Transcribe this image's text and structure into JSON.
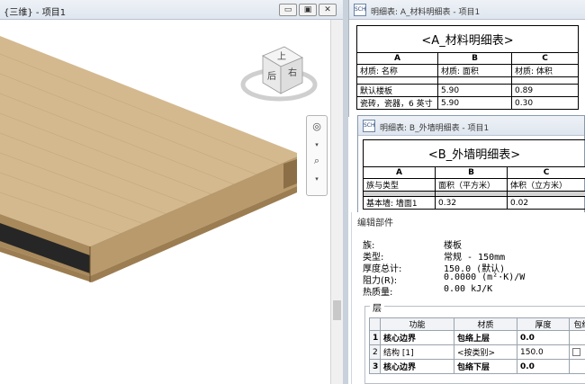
{
  "view3d": {
    "title": "{三维} - 项目1",
    "buttons": {
      "minimize": "▭",
      "restore": "▣",
      "close": "✕"
    },
    "viewcube": {
      "face_top": "上",
      "face_back": "后",
      "face_right": "右"
    }
  },
  "scheduleA": {
    "window_title": "明细表: A_材料明细表 - 项目1",
    "icon_text": "SCH",
    "title": "<A_材料明细表>",
    "letters": [
      "A",
      "B",
      "C"
    ],
    "headers": [
      "材质: 名称",
      "材质: 面积",
      "材质: 体积"
    ],
    "rows": [
      [
        "默认楼板",
        "5.90",
        "0.89"
      ],
      [
        "瓷砖，瓷器，6 英寸",
        "5.90",
        "0.30"
      ]
    ]
  },
  "scheduleB": {
    "window_title": "明细表: B_外墙明细表 - 项目1",
    "icon_text": "SCH",
    "title": "<B_外墙明细表>",
    "letters": [
      "A",
      "B",
      "C"
    ],
    "headers": [
      "族与类型",
      "面积（平方米）",
      "体积（立方米）"
    ],
    "rows": [
      [
        "基本墙: 墙面1",
        "0.32",
        "0.02"
      ]
    ]
  },
  "assembly": {
    "title": "编辑部件",
    "props": [
      {
        "label": "族:",
        "value": "楼板"
      },
      {
        "label": "类型:",
        "value": "常规 - 150mm"
      },
      {
        "label": "厚度总计:",
        "value": "150.0 (默认)"
      },
      {
        "label": "阻力(R):",
        "value": "0.0000 (m²·K)/W"
      },
      {
        "label": "热质量:",
        "value": "0.00 kJ/K"
      }
    ],
    "layers_label": "层",
    "layer_headers": [
      "",
      "功能",
      "材质",
      "厚度",
      "包络"
    ],
    "layers": [
      {
        "num": "1",
        "function": "核心边界",
        "material": "包络上层",
        "thickness": "0.0",
        "bold": true
      },
      {
        "num": "2",
        "function": "结构 [1]",
        "material": "<按类别>",
        "thickness": "150.0",
        "bold": false
      },
      {
        "num": "3",
        "function": "核心边界",
        "material": "包络下层",
        "thickness": "0.0",
        "bold": true
      }
    ]
  },
  "colors": {
    "slab_top": "#d3b88e",
    "slab_side": "#a5865a",
    "slab_dark": "#2a2a2a",
    "titlebar": "#e6ebf2"
  }
}
